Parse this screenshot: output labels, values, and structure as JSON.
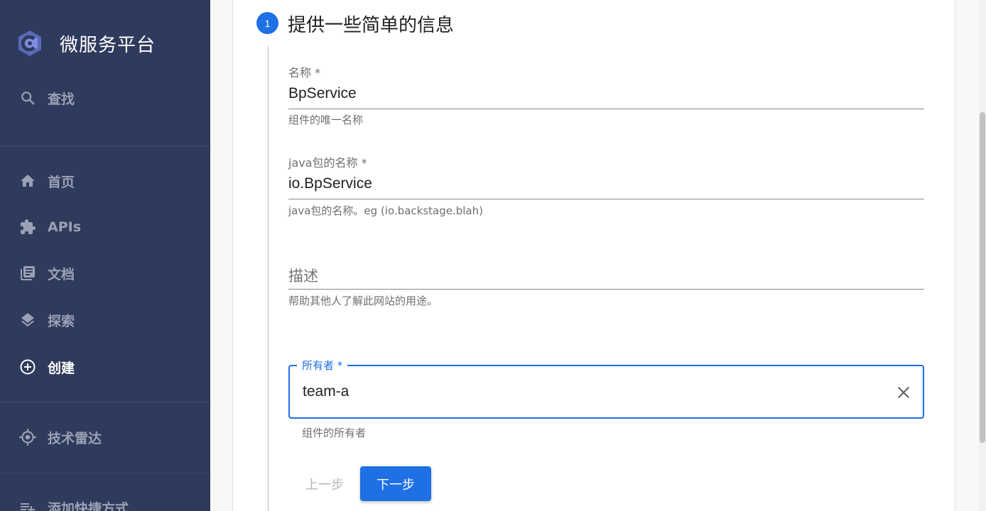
{
  "sidebar": {
    "brand": "微服务平台",
    "search": "查找",
    "items": [
      {
        "label": "首页",
        "icon": "home-icon"
      },
      {
        "label": "APIs",
        "icon": "puzzle-icon"
      },
      {
        "label": "文档",
        "icon": "library-books-icon"
      },
      {
        "label": "探索",
        "icon": "layers-icon"
      },
      {
        "label": "创建",
        "icon": "add-circle-icon",
        "active": true
      }
    ],
    "tech_radar": "技术雷达",
    "shortcuts": "添加快捷方式"
  },
  "step": {
    "number": "1",
    "title": "提供一些简单的信息"
  },
  "form": {
    "name": {
      "label": "名称 *",
      "value": "BpService",
      "help": "组件的唯一名称"
    },
    "java_package": {
      "label": "java包的名称 *",
      "value": "io.BpService",
      "help": "java包的名称。eg (io.backstage.blah)"
    },
    "description": {
      "placeholder": "描述",
      "help": "帮助其他人了解此网站的用途。"
    },
    "owner": {
      "label": "所有者 *",
      "value": "team-a",
      "help": "组件的所有者"
    }
  },
  "buttons": {
    "back": "上一步",
    "next": "下一步"
  },
  "colors": {
    "sidebar_bg": "#2f3b5c",
    "accent": "#1f6fe5"
  }
}
